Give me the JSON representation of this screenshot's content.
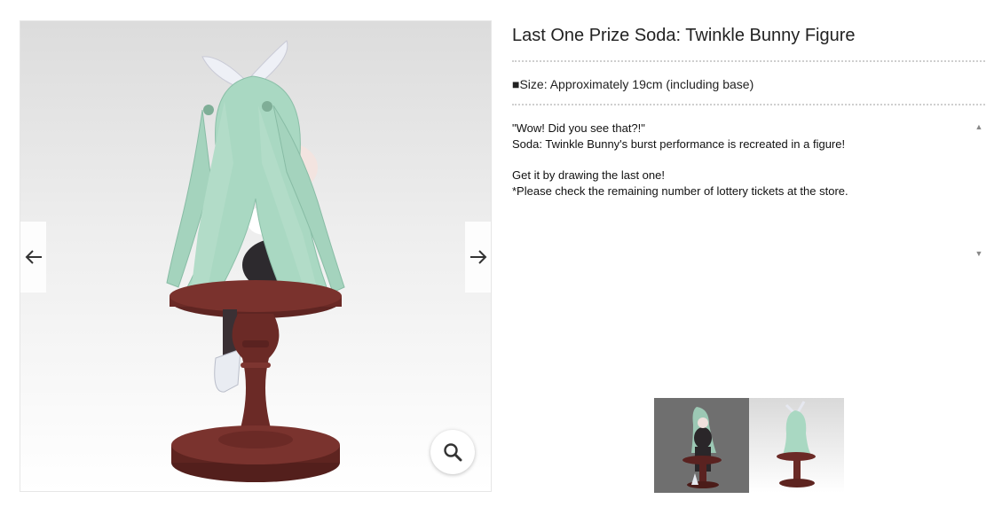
{
  "viewer": {
    "image_alt": "Soda: Twinkle Bunny figure, rear view on wooden pedestal",
    "prev_icon": "arrow-left-icon",
    "next_icon": "arrow-right-icon",
    "zoom_icon": "search-icon"
  },
  "product": {
    "title": "Last One Prize Soda: Twinkle Bunny Figure",
    "size_spec": "■Size: Approximately 19cm (including base)",
    "description": {
      "line1": "\"Wow! Did you see that?!\"",
      "line2": "Soda: Twinkle Bunny's burst performance is recreated in a figure!",
      "line3": "Get it by drawing the last one!",
      "line4": "*Please check the remaining number of lottery tickets at the store."
    },
    "scroll_up_icon": "▲",
    "scroll_down_icon": "▼"
  },
  "thumbnails": [
    {
      "alt": "Front view thumbnail"
    },
    {
      "alt": "Rear view thumbnail"
    }
  ],
  "colors": {
    "hair": "#a9d8c2",
    "pedestal": "#6b2a26",
    "text": "#222222"
  }
}
